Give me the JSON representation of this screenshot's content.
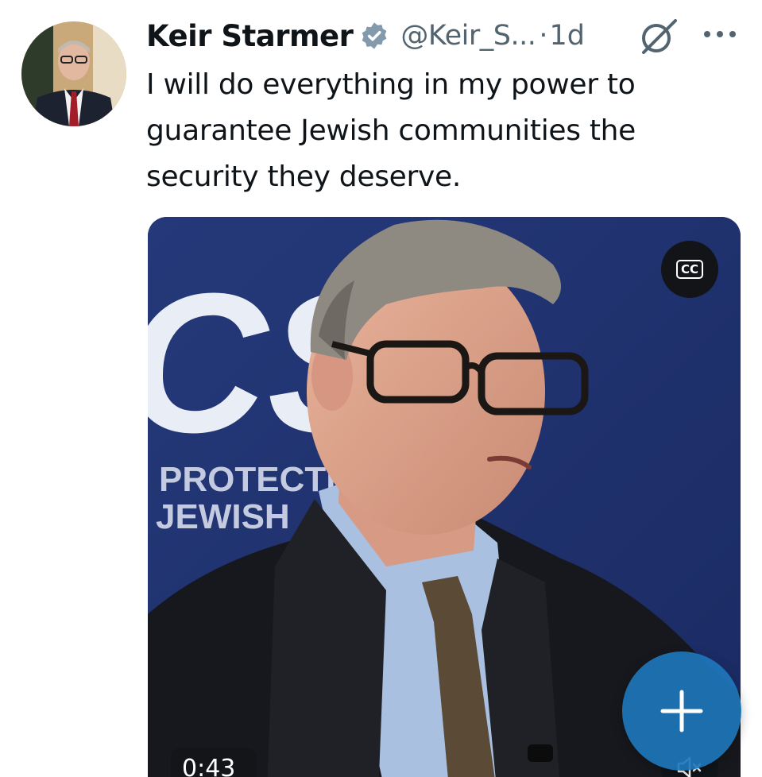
{
  "tweet": {
    "author_name": "Keir Starmer",
    "handle": "@Keir_S...",
    "separator": "·",
    "time_ago": "1d",
    "text": "I will do everything in my power to guarantee Jewish communities the security they deserve."
  },
  "media": {
    "captions_label": "CC",
    "duration": "0:43",
    "backdrop_text_lines": [
      "PROTECTI",
      "JEWISH"
    ],
    "backdrop_logo_text": "CS"
  },
  "icons": {
    "verified": "verified-badge-icon",
    "grok": "grok-icon",
    "more": "more-options-icon",
    "captions": "closed-captions-icon",
    "mute": "speaker-muted-icon",
    "compose": "plus-icon"
  },
  "colors": {
    "text_primary": "#0f1419",
    "text_secondary": "#536471",
    "verified_badge": "#829aab",
    "fab": "#1d76ba",
    "backdrop_blue": "#1d2f6d"
  }
}
